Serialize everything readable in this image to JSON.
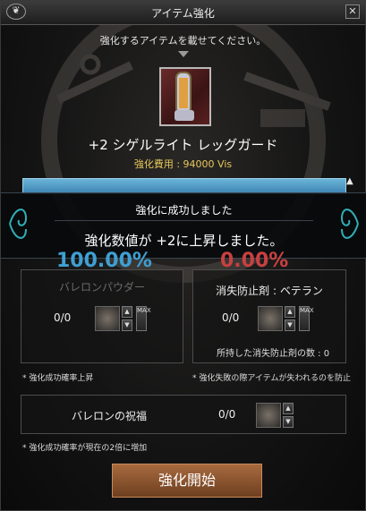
{
  "window": {
    "title": "アイテム強化",
    "menu_icon": "menu-icon",
    "close_label": "✕"
  },
  "instruction": "強化するアイテムを載せてください。",
  "item": {
    "name": "+2 シゲルライト レッグガード",
    "cost": "強化費用 : 94000 Vis",
    "icon": "leg-guard-icon"
  },
  "result": {
    "title": "強化に成功しました",
    "message": "強化数値が +2に上昇しました。"
  },
  "percentages": {
    "success": "100.00%",
    "failure": "0.00%"
  },
  "left_panel": {
    "name": "バレロンパウダー",
    "count": "0/0",
    "note": "* 強化成功確率上昇"
  },
  "right_panel": {
    "name": "消失防止剤 : ベテラン",
    "count": "0/0",
    "owned": "所持した消失防止剤の数 : 0",
    "note": "* 強化失敗の際アイテムが失われるのを防止"
  },
  "blessing": {
    "name": "バレロンの祝福",
    "count": "0/0",
    "note": "* 強化成功確率が現在の2倍に増加"
  },
  "controls": {
    "up": "▲",
    "down": "▼",
    "max": "MAX"
  },
  "start_button": "強化開始",
  "colors": {
    "progress": "#4a94c2",
    "success": "#3f9fd2",
    "failure": "#c84040",
    "cost": "#e8c95a",
    "button": "#8a5430"
  }
}
